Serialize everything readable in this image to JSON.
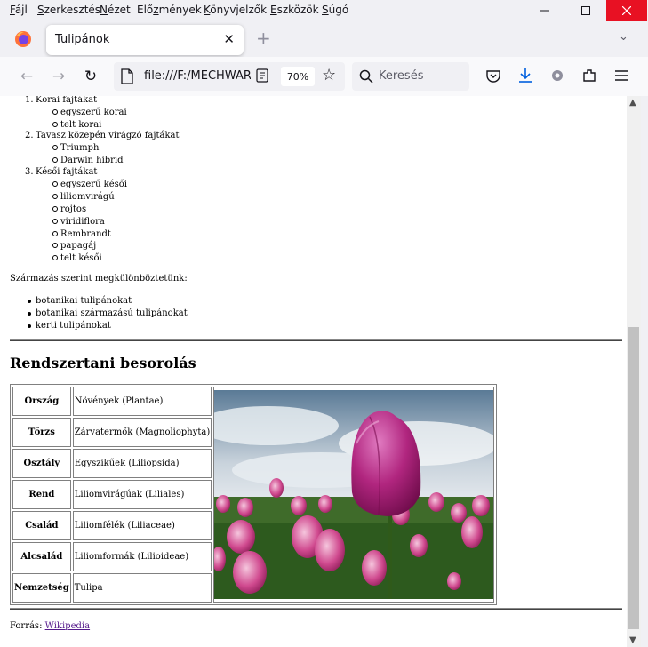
{
  "menu": {
    "items": [
      {
        "pre": "",
        "u": "F",
        "post": "ájl"
      },
      {
        "pre": "",
        "u": "S",
        "post": "zerkesztés"
      },
      {
        "pre": "",
        "u": "N",
        "post": "ézet"
      },
      {
        "pre": "Elő",
        "u": "z",
        "post": "mények"
      },
      {
        "pre": "",
        "u": "K",
        "post": "önyvjelzők"
      },
      {
        "pre": "",
        "u": "E",
        "post": "szközök"
      },
      {
        "pre": "",
        "u": "S",
        "post": "úgó"
      }
    ]
  },
  "tab": {
    "title": "Tulipánok"
  },
  "nav": {
    "url": "file:///F:/MECHWAR",
    "zoom": "70%",
    "search_placeholder": "Keresés"
  },
  "page": {
    "ordered": [
      {
        "num": "1.",
        "label": "Korai fajtákat",
        "subs": [
          "egyszerű korai",
          "telt korai"
        ]
      },
      {
        "num": "2.",
        "label": "Tavasz közepén virágzó fajtákat",
        "subs": [
          "Triumph",
          "Darwin hibrid"
        ]
      },
      {
        "num": "3.",
        "label": "Késői fajtákat",
        "subs": [
          "egyszerű késői",
          "liliomvirágú",
          "rojtos",
          "viridiflora",
          "Rembrandt",
          "papagáj",
          "telt késői"
        ]
      }
    ],
    "origin_intro": "Származás szerint megkülönböztetünk:",
    "origin_list": [
      "botanikai tulipánokat",
      "botanikai származású tulipánokat",
      "kerti tulipánokat"
    ],
    "heading": "Rendszertani besorolás",
    "taxonomy": [
      {
        "rank": "Ország",
        "value": "Növények (Plantae)"
      },
      {
        "rank": "Törzs",
        "value": "Zárvatermők (Magnoliophyta)"
      },
      {
        "rank": "Osztály",
        "value": "Egyszikűek (Liliopsida)"
      },
      {
        "rank": "Rend",
        "value": "Liliomvirágúak (Liliales)"
      },
      {
        "rank": "Család",
        "value": "Liliomfélék (Liliaceae)"
      },
      {
        "rank": "Alcsalád",
        "value": "Liliomformák (Lilioideae)"
      },
      {
        "rank": "Nemzetség",
        "value": "Tulipa"
      }
    ],
    "source_label": "Forrás:",
    "source_link": "Wikipedia"
  },
  "colors": {
    "accent": "#0060df",
    "link": "#551a8b",
    "close": "#e81123"
  }
}
